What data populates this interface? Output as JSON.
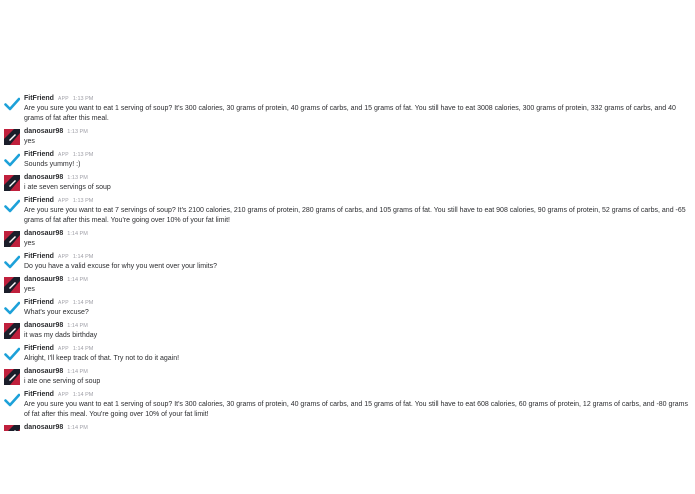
{
  "colors": {
    "bot_check": "#1da1d9",
    "user_avatar_red": "#c0203d",
    "user_avatar_dark": "#1b1e2a",
    "user_avatar_white": "#ffffff"
  },
  "icons": {
    "bot": "checkmark-icon",
    "user": "geometric-avatar-icon"
  },
  "messages": [
    {
      "sender": "FitFriend",
      "is_app": true,
      "app_badge": "APP",
      "time": "1:13 PM",
      "text": "Are you sure you want to eat 1 serving of soup? It's 300 calories, 30 grams of protein, 40 grams of carbs, and 15 grams of fat. You still have to eat 3008 calories, 300 grams of protein, 332 grams of carbs, and 40 grams of fat after this meal."
    },
    {
      "sender": "danosaur98",
      "is_app": false,
      "app_badge": "",
      "time": "1:13 PM",
      "text": "yes"
    },
    {
      "sender": "FitFriend",
      "is_app": true,
      "app_badge": "APP",
      "time": "1:13 PM",
      "text": "Sounds yummy! :)"
    },
    {
      "sender": "danosaur98",
      "is_app": false,
      "app_badge": "",
      "time": "1:13 PM",
      "text": "i ate seven servings of soup"
    },
    {
      "sender": "FitFriend",
      "is_app": true,
      "app_badge": "APP",
      "time": "1:13 PM",
      "text": "Are you sure you want to eat 7 servings of soup? It's 2100 calories, 210 grams of protein, 280 grams of carbs, and 105 grams of fat. You still have to eat 908 calories, 90 grams of protein, 52 grams of carbs, and -65 grams of fat after this meal. You're going over 10% of your fat limit!"
    },
    {
      "sender": "danosaur98",
      "is_app": false,
      "app_badge": "",
      "time": "1:14 PM",
      "text": "yes"
    },
    {
      "sender": "FitFriend",
      "is_app": true,
      "app_badge": "APP",
      "time": "1:14 PM",
      "text": "Do you have a valid excuse for why you went over your limits?"
    },
    {
      "sender": "danosaur98",
      "is_app": false,
      "app_badge": "",
      "time": "1:14 PM",
      "text": "yes"
    },
    {
      "sender": "FitFriend",
      "is_app": true,
      "app_badge": "APP",
      "time": "1:14 PM",
      "text": "What's your excuse?"
    },
    {
      "sender": "danosaur98",
      "is_app": false,
      "app_badge": "",
      "time": "1:14 PM",
      "text": "it was my dads birthday"
    },
    {
      "sender": "FitFriend",
      "is_app": true,
      "app_badge": "APP",
      "time": "1:14 PM",
      "text": "Alright, I'll keep track of that. Try not to do it again!"
    },
    {
      "sender": "danosaur98",
      "is_app": false,
      "app_badge": "",
      "time": "1:14 PM",
      "text": "i ate one serving of soup"
    },
    {
      "sender": "FitFriend",
      "is_app": true,
      "app_badge": "APP",
      "time": "1:14 PM",
      "text": "Are you sure you want to eat 1 serving of soup? It's 300 calories, 30 grams of protein, 40 grams of carbs, and 15 grams of fat. You still have to eat 608 calories, 60 grams of protein, 12 grams of carbs, and -80 grams of fat after this meal. You're going over 10% of your fat limit!"
    },
    {
      "sender": "danosaur98",
      "is_app": false,
      "app_badge": "",
      "time": "1:14 PM",
      "text": ""
    }
  ]
}
